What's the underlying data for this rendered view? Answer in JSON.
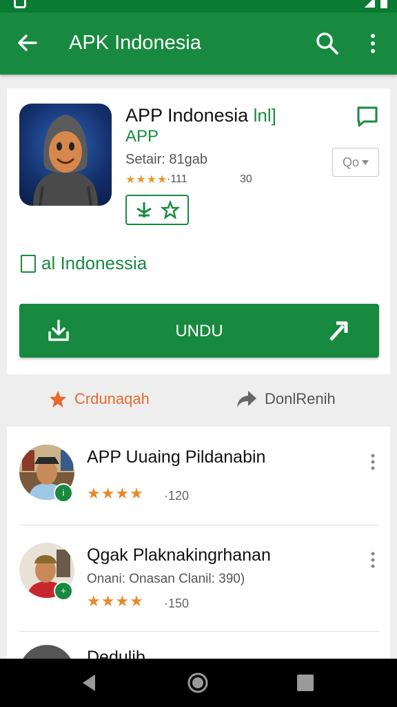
{
  "appbar": {
    "title": "APK Indonesia"
  },
  "app": {
    "name": "APP Indonesia",
    "name_tag": "lnl]",
    "subtitle": "APP",
    "developer": "Setair: 81gab",
    "stars": "★★★★",
    "rating_count": "·111",
    "extra": "30",
    "rate_label": "Qo"
  },
  "check_label": "al Indonessia",
  "install_button": {
    "label": "UNDU"
  },
  "actions": {
    "left_label": "Crdunaqah",
    "right_label": "DonlRenih"
  },
  "reviews": [
    {
      "name": "APP Uuaing Pildanabin",
      "desc": "",
      "stars": "★★★★",
      "count": "·120"
    },
    {
      "name": "Qgak Plaknakingrhanan",
      "desc": "Onani: Onasan Clanil: 390)",
      "stars": "★★★★",
      "count": "·150"
    },
    {
      "name": "Dedulib",
      "desc": "",
      "stars": "",
      "count": ""
    }
  ],
  "colors": {
    "primary": "#188a3f",
    "accent_orange": "#e56a2c",
    "star": "#e9992a"
  }
}
